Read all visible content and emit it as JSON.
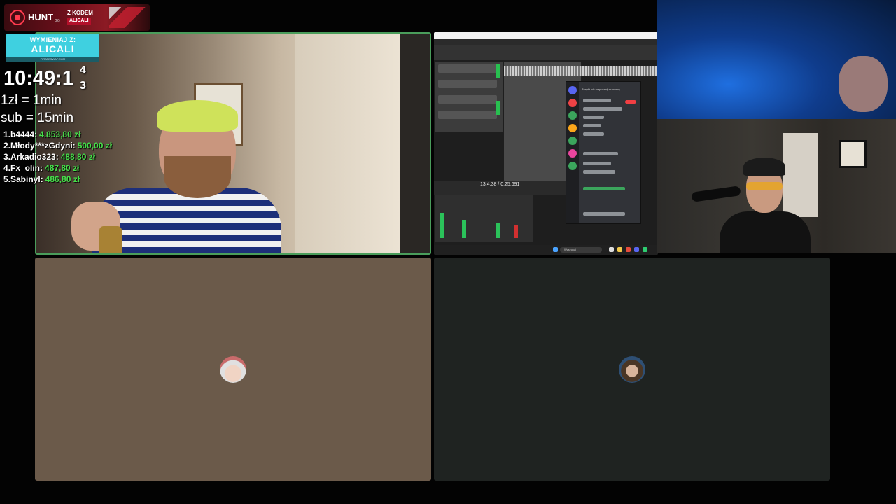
{
  "overlay": {
    "brand": "HUNT",
    "brand_superscript": "GG",
    "code_label": "Z KODEM",
    "code_value": "ALICALI",
    "cta_line1": "WYMIENIAJ Z:",
    "cta_line2": "ALICALI",
    "cta_footer": "PIRATESWAP.COM",
    "timer": "10:49:1",
    "timer_digit_top": "4",
    "timer_digit_bottom": "3",
    "rate_1": "1zł = 1min",
    "rate_2": "sub = 15min",
    "leaderboard": [
      {
        "name": "1.b4444:",
        "amount": "4.853,80 zł"
      },
      {
        "name": "2.Młody***zGdyni:",
        "amount": "500,00 zł"
      },
      {
        "name": "3.Arkadio323:",
        "amount": "488,80 zł"
      },
      {
        "name": "4.Fx_olin:",
        "amount": "487,80 zł"
      },
      {
        "name": "5.Sabinyl:",
        "amount": "486,80 zł"
      }
    ],
    "accent_green": "#46e04a",
    "accent_red": "#b3102a",
    "cta_color": "#3fd0e0"
  },
  "screenshare": {
    "daw_time": "13.4.38 / 0:25.691",
    "discord_title": "Znajdź lub rozpocznij rozmowę",
    "taskbar_search": "Wyszukaj"
  },
  "tiles": {
    "active_speaker_border": "#4a9d5b",
    "user_a_bg": "#6b5a4a",
    "user_b_bg": "#1f2321"
  }
}
